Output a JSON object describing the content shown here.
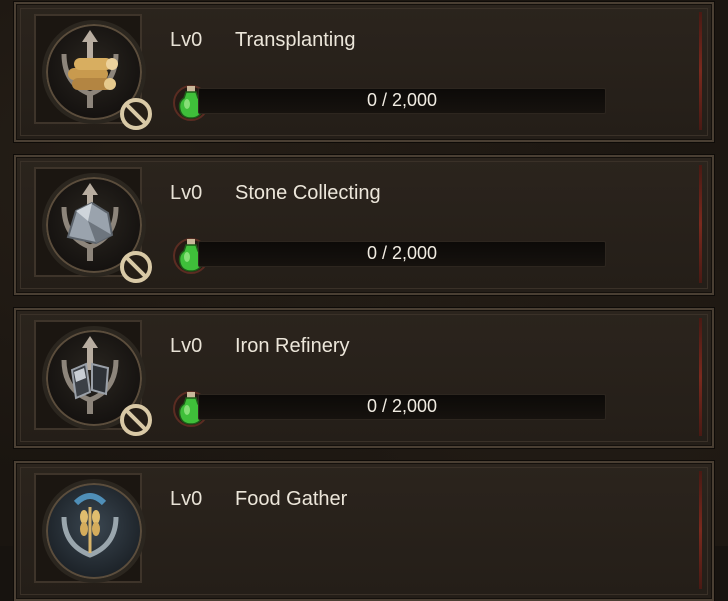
{
  "skills": [
    {
      "level": "Lv0",
      "name": "Transplanting",
      "progress_text": "0 / 2,000",
      "progress": 0,
      "emblem": "lumber-icon"
    },
    {
      "level": "Lv0",
      "name": "Stone Collecting",
      "progress_text": "0 / 2,000",
      "progress": 0,
      "emblem": "stone-icon"
    },
    {
      "level": "Lv0",
      "name": "Iron Refinery",
      "progress_text": "0 / 2,000",
      "progress": 0,
      "emblem": "iron-icon"
    },
    {
      "level": "Lv0",
      "name": "Food Gather",
      "progress_text": "",
      "progress": 0,
      "emblem": "wheat-icon"
    }
  ],
  "colors": {
    "card": "#2b241d",
    "bar_track": "#0c0a08",
    "text": "#ece6da",
    "potion_green": "#3fbf3a",
    "forbid_ring": "#d9c9a6"
  }
}
